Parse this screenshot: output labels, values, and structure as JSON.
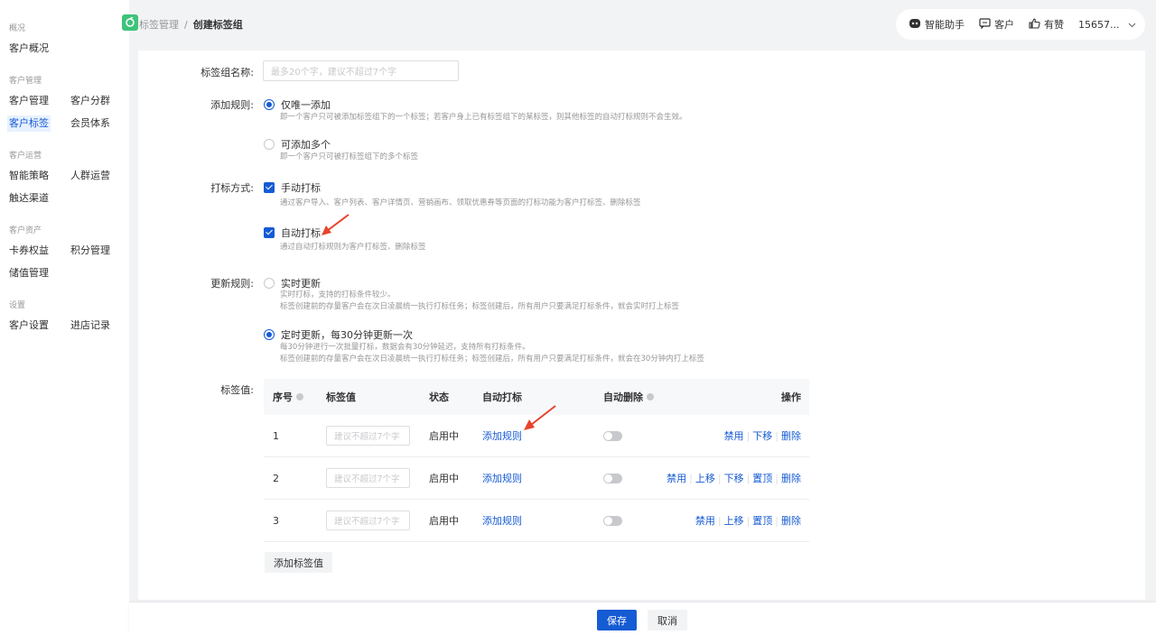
{
  "sidebar": {
    "groups": [
      {
        "label": "概况",
        "items": [
          "客户概况"
        ]
      },
      {
        "label": "客户管理",
        "items": [
          "客户管理",
          "客户分群",
          "客户标签",
          "会员体系"
        ]
      },
      {
        "label": "客户运营",
        "items": [
          "智能策略",
          "人群运营",
          "触达渠道"
        ]
      },
      {
        "label": "客户资产",
        "items": [
          "卡券权益",
          "积分管理",
          "储值管理"
        ]
      },
      {
        "label": "设置",
        "items": [
          "客户设置",
          "进店记录"
        ]
      }
    ],
    "active_item": "客户标签"
  },
  "header": {
    "breadcrumb_parent": "标签管理",
    "breadcrumb_sep": "/",
    "breadcrumb_current": "创建标签组",
    "tools": {
      "assistant": "智能助手",
      "customer": "客户",
      "youzan": "有赞",
      "account": "15657..."
    }
  },
  "form": {
    "name": {
      "label": "标签组名称:",
      "placeholder": "最多20个字，建议不超过7个字"
    },
    "add_rule": {
      "label": "添加规则:",
      "options": [
        {
          "label": "仅唯一添加",
          "checked": true,
          "hint": "即一个客户只可被添加标签组下的一个标签；若客户身上已有标签组下的某标签，则其他标签的自动打标规则不会生效。"
        },
        {
          "label": "可添加多个",
          "checked": false,
          "hint": "即一个客户只可被打标签组下的多个标签"
        }
      ]
    },
    "tag_method": {
      "label": "打标方式:",
      "options": [
        {
          "label": "手动打标",
          "checked": true,
          "hint": "通过客户导入、客户列表、客户详情页、营销画布、领取优惠券等页面的打标功能为客户打标签、删除标签"
        },
        {
          "label": "自动打标",
          "checked": true,
          "hint": "通过自动打标规则为客户打标签、删除标签"
        }
      ]
    },
    "update_rule": {
      "label": "更新规则:",
      "options": [
        {
          "label": "实时更新",
          "checked": false,
          "hint1": "实时打标，支持的打标条件较少。",
          "hint2": "标签创建前的存量客户会在次日凌晨统一执行打标任务；标签创建后，所有用户只要满足打标条件，就会实时打上标签"
        },
        {
          "label": "定时更新，每30分钟更新一次",
          "checked": true,
          "hint1": "每30分钟进行一次批量打标，数据会有30分钟延迟，支持所有打标条件。",
          "hint2": "标签创建前的存量客户会在次日凌晨统一执行打标任务；标签创建后，所有用户只要满足打标条件，就会在30分钟内打上标签"
        }
      ]
    },
    "tag_values": {
      "label": "标签值:",
      "columns": {
        "index": "序号",
        "value": "标签值",
        "status": "状态",
        "auto_tag": "自动打标",
        "auto_delete": "自动删除",
        "actions": "操作"
      },
      "rows": [
        {
          "index": "1",
          "placeholder": "建议不超过7个字",
          "status": "启用中",
          "auto_tag": "添加规则",
          "auto_delete_on": false,
          "actions": [
            "禁用",
            "下移",
            "删除"
          ]
        },
        {
          "index": "2",
          "placeholder": "建议不超过7个字",
          "status": "启用中",
          "auto_tag": "添加规则",
          "auto_delete_on": false,
          "actions": [
            "禁用",
            "上移",
            "下移",
            "置顶",
            "删除"
          ]
        },
        {
          "index": "3",
          "placeholder": "建议不超过7个字",
          "status": "启用中",
          "auto_tag": "添加规则",
          "auto_delete_on": false,
          "actions": [
            "禁用",
            "上移",
            "置顶",
            "删除"
          ]
        }
      ],
      "add_button": "添加标签值"
    }
  },
  "footer": {
    "save": "保存",
    "cancel": "取消"
  },
  "colors": {
    "primary": "#155bd4",
    "arrow": "#e8432d",
    "logo": "#3ec37b"
  }
}
